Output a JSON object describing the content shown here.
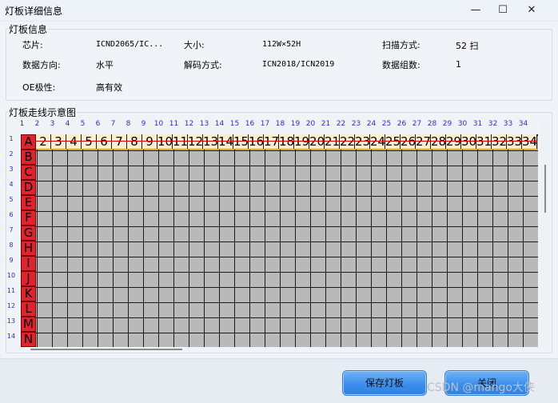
{
  "window": {
    "title": "灯板详细信息",
    "minimize": "—",
    "maximize": "☐",
    "close": "✕"
  },
  "info_group": {
    "label": "灯板信息",
    "chip_label": "芯片:",
    "chip_value": "ICND2065/IC...",
    "size_label": "大小:",
    "size_value": "112W×52H",
    "scan_label": "扫描方式:",
    "scan_value": "52 扫",
    "direction_label": "数据方向:",
    "direction_value": "水平",
    "decode_label": "解码方式:",
    "decode_value": "ICN2018/ICN2019",
    "groups_label": "数据组数:",
    "groups_value": "1",
    "oe_label": "OE极性:",
    "oe_value": "高有效"
  },
  "diagram_group": {
    "label": "灯板走线示意图",
    "col_numbers": [
      "1",
      "2",
      "3",
      "4",
      "5",
      "6",
      "7",
      "8",
      "9",
      "10",
      "11",
      "12",
      "13",
      "14",
      "15",
      "16",
      "17",
      "18",
      "19",
      "20",
      "21",
      "22",
      "23",
      "24",
      "25",
      "26",
      "27",
      "28",
      "29",
      "30",
      "31",
      "32",
      "33",
      "34"
    ],
    "row_numbers": [
      "1",
      "2",
      "3",
      "4",
      "5",
      "6",
      "7",
      "8",
      "9",
      "10",
      "11",
      "12",
      "13",
      "14"
    ],
    "header_cells": [
      "2",
      "3",
      "4",
      "5",
      "6",
      "7",
      "8",
      "9",
      "10",
      "11",
      "12",
      "13",
      "14",
      "15",
      "16",
      "17",
      "18",
      "19",
      "20",
      "21",
      "22",
      "23",
      "24",
      "25",
      "26",
      "27",
      "28",
      "29",
      "30",
      "31",
      "32",
      "33",
      "34"
    ],
    "row_letters": [
      "A",
      "B",
      "C",
      "D",
      "E",
      "F",
      "G",
      "H",
      "I",
      "J",
      "K",
      "L",
      "M",
      "N"
    ]
  },
  "buttons": {
    "save": "保存灯板",
    "close": "关闭"
  },
  "watermark": "CSDN @mango大侠"
}
